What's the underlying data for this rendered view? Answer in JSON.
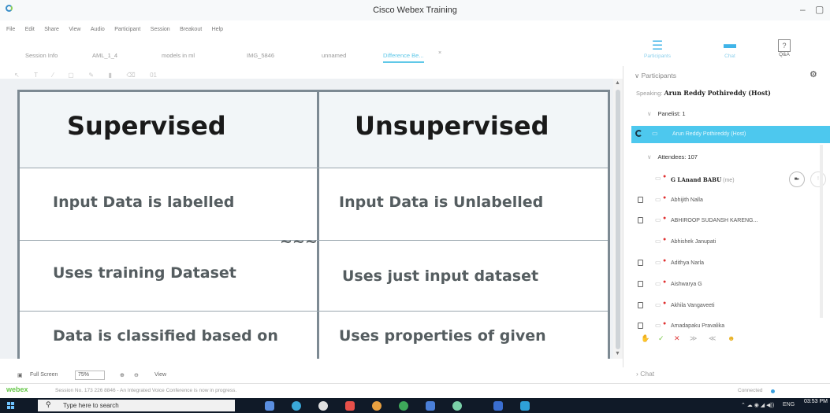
{
  "window": {
    "title": "Cisco Webex Training"
  },
  "menu": [
    "File",
    "Edit",
    "Share",
    "View",
    "Audio",
    "Participant",
    "Session",
    "Breakout",
    "Help"
  ],
  "tabs": [
    "Session Info",
    "AML_1_4",
    "models in ml",
    "IMG_5846",
    "unnamed",
    "Difference Be..."
  ],
  "active_tab": "Difference Be...",
  "annotation_zoom": "01",
  "panel_tools": [
    {
      "label": "Participants",
      "icon": "participants-icon"
    },
    {
      "label": "Chat",
      "icon": "chat-icon"
    },
    {
      "label": "Q&A",
      "icon": "qa-icon"
    }
  ],
  "slide": {
    "headers": [
      "Supervised",
      "Unsupervised"
    ],
    "rows": [
      [
        "Input Data is labelled",
        "Input Data is Unlabelled"
      ],
      [
        "Uses training Dataset",
        "Uses just input dataset"
      ],
      [
        "Data is classified based on",
        "Uses properties of given"
      ]
    ]
  },
  "viewbar": {
    "full_screen": "Full Screen",
    "zoom": "75%",
    "view": "View"
  },
  "participants": {
    "header": "Participants",
    "speaking_label": "Speaking:",
    "speaking_name": "Arun Reddy Pothireddy (Host)",
    "panelist_group": "Panelist: 1",
    "host_name": "Arun Reddy Pothireddy (Host)",
    "attendees_group": "Attendees: 107",
    "me_name": "G LAnand BABU",
    "me_suffix": "(me)",
    "attendees": [
      "Abhijith Nalla",
      "ABHIROOP SUDANSH KARENG...",
      "Abhishek Janupati",
      "Adithya Narla",
      "Aishwarya G",
      "Akhila Vangaveeti",
      "Amadapaku Pravalika"
    ]
  },
  "chat_section": "Chat",
  "status": {
    "brand": "webex",
    "message": "Session No. 173 226 8846 - An Integrated Voice Conference is now in progress.",
    "connection": "Connected"
  },
  "taskbar": {
    "search_placeholder": "Type here to search",
    "lang": "ENG",
    "time": "03:53 PM"
  },
  "colors": {
    "accent": "#4dc8ee",
    "slide_border": "#7d8a93",
    "taskbar": "#101a28",
    "brand": "#67c74a"
  }
}
